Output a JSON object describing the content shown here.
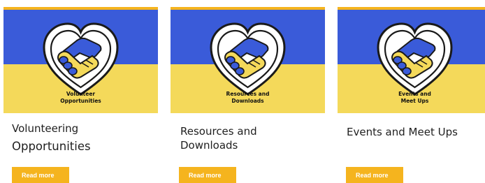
{
  "colors": {
    "blue": "#3a5bd9",
    "yellow": "#f4d95a",
    "accent_bar": "#f5b41e",
    "button": "#f5b41e"
  },
  "cards": [
    {
      "image_caption_line1": "Volunteer",
      "image_caption_line2": "Opportunities",
      "image_icon": "heart-handshake-icon",
      "title_line1": "Volunteering",
      "title_line2": "Opportunities",
      "button_label": "Read more"
    },
    {
      "image_caption_line1": "Resources and",
      "image_caption_line2": "Downloads",
      "image_icon": "heart-handshake-icon",
      "title_line1": "Resources and",
      "title_line2": "Downloads",
      "button_label": "Read more"
    },
    {
      "image_caption_line1": "Events and",
      "image_caption_line2": "Meet Ups",
      "image_icon": "heart-handshake-icon",
      "title_line1": "Events and Meet Ups",
      "title_line2": "",
      "button_label": "Read more"
    }
  ]
}
